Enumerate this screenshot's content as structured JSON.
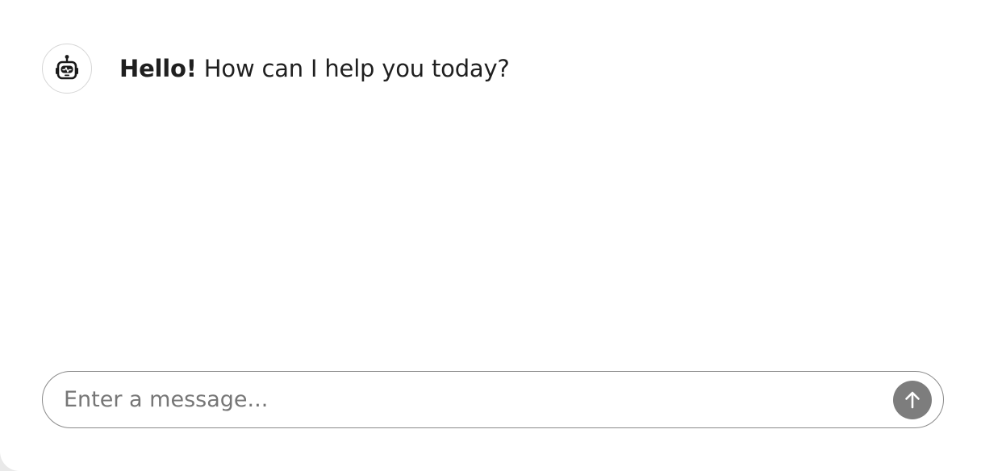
{
  "chat": {
    "messages": [
      {
        "sender_icon": "robot-icon",
        "greeting": "Hello!",
        "text": " How can I help you today?"
      }
    ]
  },
  "composer": {
    "placeholder": "Enter a message...",
    "value": "",
    "send_icon": "arrow-up-icon"
  },
  "colors": {
    "send_button_bg": "#7d7d7d",
    "text": "#1f1f1f",
    "border": "#8a8a8a"
  }
}
